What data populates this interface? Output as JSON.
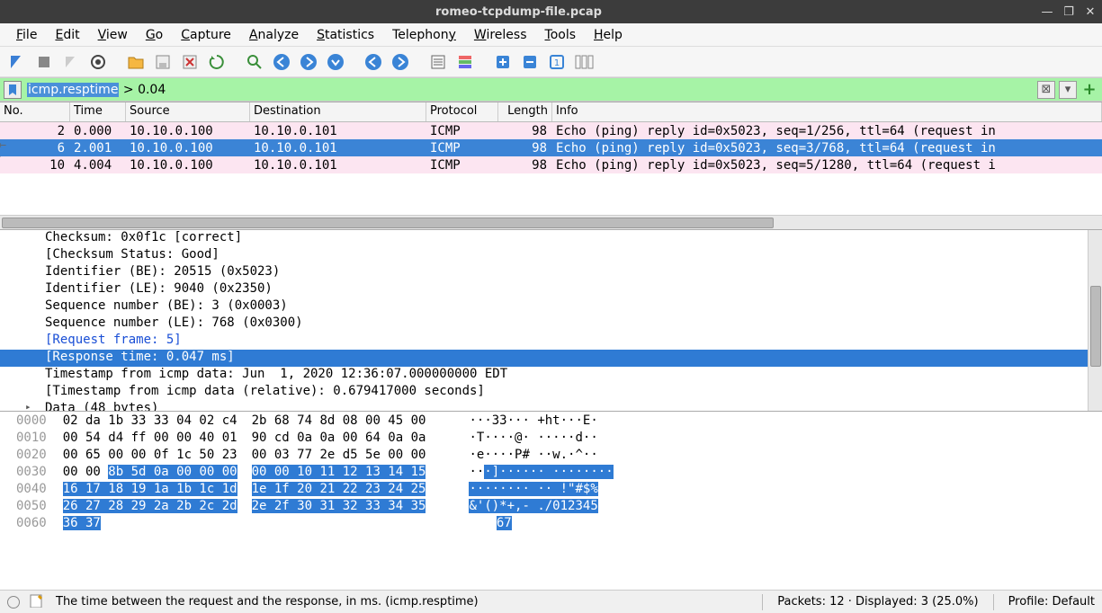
{
  "window": {
    "title": "romeo-tcpdump-file.pcap",
    "min": "—",
    "max": "❐",
    "close": "✕"
  },
  "menu": {
    "file": "File",
    "edit": "Edit",
    "view": "View",
    "go": "Go",
    "capture": "Capture",
    "analyze": "Analyze",
    "statistics": "Statistics",
    "telephony": "Telephony",
    "wireless": "Wireless",
    "tools": "Tools",
    "help": "Help"
  },
  "filter": {
    "selected": "icmp.resptime",
    "rest": " > 0.04"
  },
  "columns": {
    "no": "No.",
    "time": "Time",
    "source": "Source",
    "destination": "Destination",
    "protocol": "Protocol",
    "length": "Length",
    "info": "Info"
  },
  "rows": [
    {
      "no": "2",
      "time": "0.000",
      "src": "10.10.0.100",
      "dst": "10.10.0.101",
      "proto": "ICMP",
      "len": "98",
      "info": "Echo (ping) reply    id=0x5023, seq=1/256, ttl=64 (request in"
    },
    {
      "no": "6",
      "time": "2.001",
      "src": "10.10.0.100",
      "dst": "10.10.0.101",
      "proto": "ICMP",
      "len": "98",
      "info": "Echo (ping) reply    id=0x5023, seq=3/768, ttl=64 (request in"
    },
    {
      "no": "10",
      "time": "4.004",
      "src": "10.10.0.100",
      "dst": "10.10.0.101",
      "proto": "ICMP",
      "len": "98",
      "info": "Echo (ping) reply    id=0x5023, seq=5/1280, ttl=64 (request i"
    }
  ],
  "details": {
    "l0": "Checksum: 0x0f1c [correct]",
    "l1": "[Checksum Status: Good]",
    "l2": "Identifier (BE): 20515 (0x5023)",
    "l3": "Identifier (LE): 9040 (0x2350)",
    "l4": "Sequence number (BE): 3 (0x0003)",
    "l5": "Sequence number (LE): 768 (0x0300)",
    "l6": "[Request frame: 5]",
    "l7": "[Response time: 0.047 ms]",
    "l8": "Timestamp from icmp data: Jun  1, 2020 12:36:07.000000000 EDT",
    "l9": "[Timestamp from icmp data (relative): 0.679417000 seconds]",
    "l10": "Data (48 bytes)"
  },
  "hex": {
    "r0": {
      "off": "0000",
      "a": "02 da 1b 33 33 04 02 c4",
      "b": "2b 68 74 8d 08 00 45 00",
      "asc": "···33··· +ht···E·"
    },
    "r1": {
      "off": "0010",
      "a": "00 54 d4 ff 00 00 40 01",
      "b": "90 cd 0a 0a 00 64 0a 0a",
      "asc": "·T····@· ·····d··"
    },
    "r2": {
      "off": "0020",
      "a": "00 65 00 00 0f 1c 50 23",
      "b": "00 03 77 2e d5 5e 00 00",
      "asc": "·e····P# ··w.·^··"
    },
    "r3": {
      "off": "0030",
      "a_plain": "00 00 ",
      "a_hl": "8b 5d 0a 00 00 00",
      "b_hl": "00 00 10 11 12 13 14 15",
      "asc_plain": "··",
      "asc_hl": "·]······ ········"
    },
    "r4": {
      "off": "0040",
      "a_hl": "16 17 18 19 1a 1b 1c 1d",
      "b_hl": "1e 1f 20 21 22 23 24 25",
      "asc_hl": "········ ·· !\"#$%"
    },
    "r5": {
      "off": "0050",
      "a_hl": "26 27 28 29 2a 2b 2c 2d",
      "b_hl": "2e 2f 30 31 32 33 34 35",
      "asc_hl": "&'()*+,- ./012345"
    },
    "r6": {
      "off": "0060",
      "a_hl": "36 37",
      "asc_hl": "67"
    }
  },
  "status": {
    "msg": "The time between the request and the response, in ms. (icmp.resptime)",
    "pkts": "Packets: 12 · Displayed: 3 (25.0%)",
    "profile": "Profile: Default"
  }
}
